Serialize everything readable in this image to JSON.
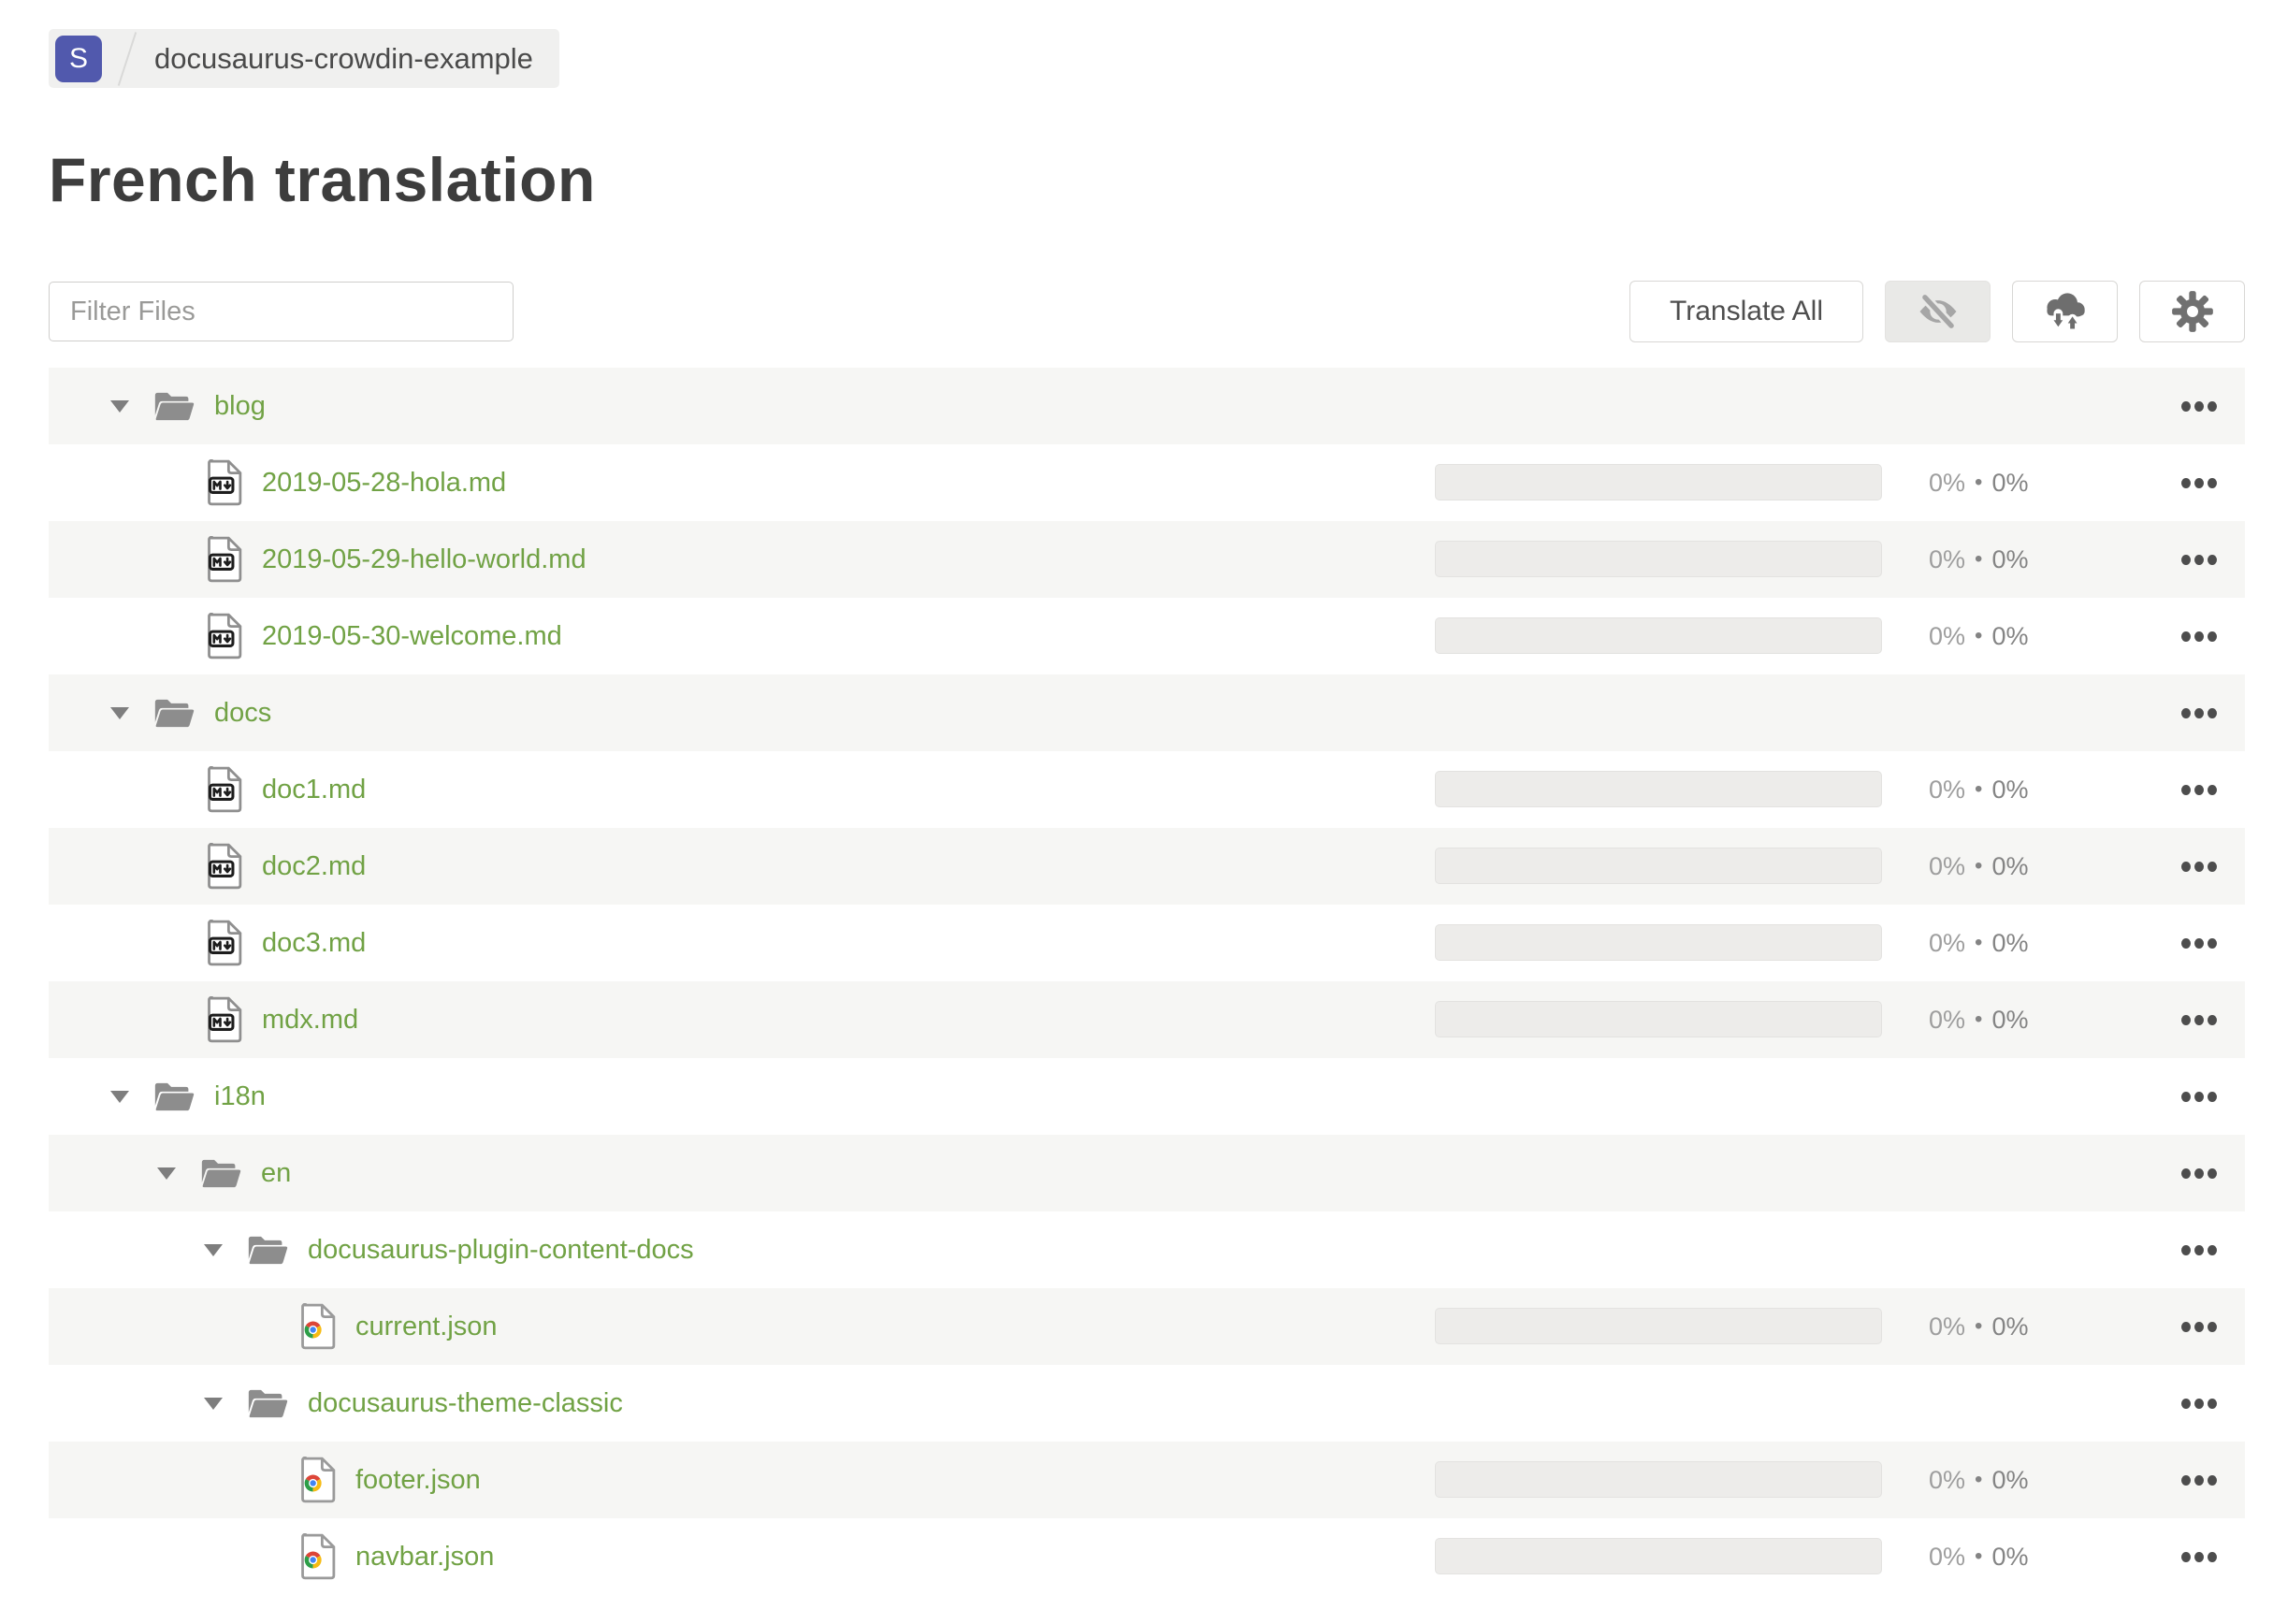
{
  "breadcrumb": {
    "project_initial": "S",
    "project_name": "docusaurus-crowdin-example"
  },
  "page": {
    "title": "French translation"
  },
  "toolbar": {
    "filter_placeholder": "Filter Files",
    "translate_all_label": "Translate All",
    "icon_buttons": [
      {
        "icon": "eye-slash-icon",
        "active": true
      },
      {
        "icon": "cloud-sync-icon",
        "active": false
      },
      {
        "icon": "gear-icon",
        "active": false
      }
    ]
  },
  "colors": {
    "accent_green": "#71a245",
    "badge_indigo": "#5159ad",
    "row_shaded": "#f6f6f4",
    "folder_gray": "#8d8d8d",
    "progress_track": "#edecea"
  },
  "tree": {
    "progress_separator": "•",
    "rows": [
      {
        "name": "blog",
        "type": "folder",
        "icon": "folder",
        "level": 0,
        "expanded": true,
        "progress": null
      },
      {
        "name": "2019-05-28-hola.md",
        "type": "file",
        "icon": "markdown",
        "level": 1,
        "progress": {
          "translated": "0%",
          "approved": "0%",
          "bar_fill": 0
        }
      },
      {
        "name": "2019-05-29-hello-world.md",
        "type": "file",
        "icon": "markdown",
        "level": 1,
        "progress": {
          "translated": "0%",
          "approved": "0%",
          "bar_fill": 0
        }
      },
      {
        "name": "2019-05-30-welcome.md",
        "type": "file",
        "icon": "markdown",
        "level": 1,
        "progress": {
          "translated": "0%",
          "approved": "0%",
          "bar_fill": 0
        }
      },
      {
        "name": "docs",
        "type": "folder",
        "icon": "folder",
        "level": 0,
        "expanded": true,
        "progress": null
      },
      {
        "name": "doc1.md",
        "type": "file",
        "icon": "markdown",
        "level": 1,
        "progress": {
          "translated": "0%",
          "approved": "0%",
          "bar_fill": 0
        }
      },
      {
        "name": "doc2.md",
        "type": "file",
        "icon": "markdown",
        "level": 1,
        "progress": {
          "translated": "0%",
          "approved": "0%",
          "bar_fill": 0
        }
      },
      {
        "name": "doc3.md",
        "type": "file",
        "icon": "markdown",
        "level": 1,
        "progress": {
          "translated": "0%",
          "approved": "0%",
          "bar_fill": 0
        }
      },
      {
        "name": "mdx.md",
        "type": "file",
        "icon": "markdown",
        "level": 1,
        "progress": {
          "translated": "0%",
          "approved": "0%",
          "bar_fill": 0
        }
      },
      {
        "name": "i18n",
        "type": "folder",
        "icon": "folder",
        "level": 0,
        "expanded": true,
        "progress": null
      },
      {
        "name": "en",
        "type": "folder",
        "icon": "folder",
        "level": 1,
        "expanded": true,
        "progress": null
      },
      {
        "name": "docusaurus-plugin-content-docs",
        "type": "folder",
        "icon": "folder",
        "level": 2,
        "expanded": true,
        "progress": null
      },
      {
        "name": "current.json",
        "type": "file",
        "icon": "json",
        "level": 3,
        "progress": {
          "translated": "0%",
          "approved": "0%",
          "bar_fill": 0
        }
      },
      {
        "name": "docusaurus-theme-classic",
        "type": "folder",
        "icon": "folder",
        "level": 2,
        "expanded": true,
        "progress": null
      },
      {
        "name": "footer.json",
        "type": "file",
        "icon": "json",
        "level": 3,
        "progress": {
          "translated": "0%",
          "approved": "0%",
          "bar_fill": 0
        }
      },
      {
        "name": "navbar.json",
        "type": "file",
        "icon": "json",
        "level": 3,
        "progress": {
          "translated": "0%",
          "approved": "0%",
          "bar_fill": 0
        }
      }
    ]
  }
}
